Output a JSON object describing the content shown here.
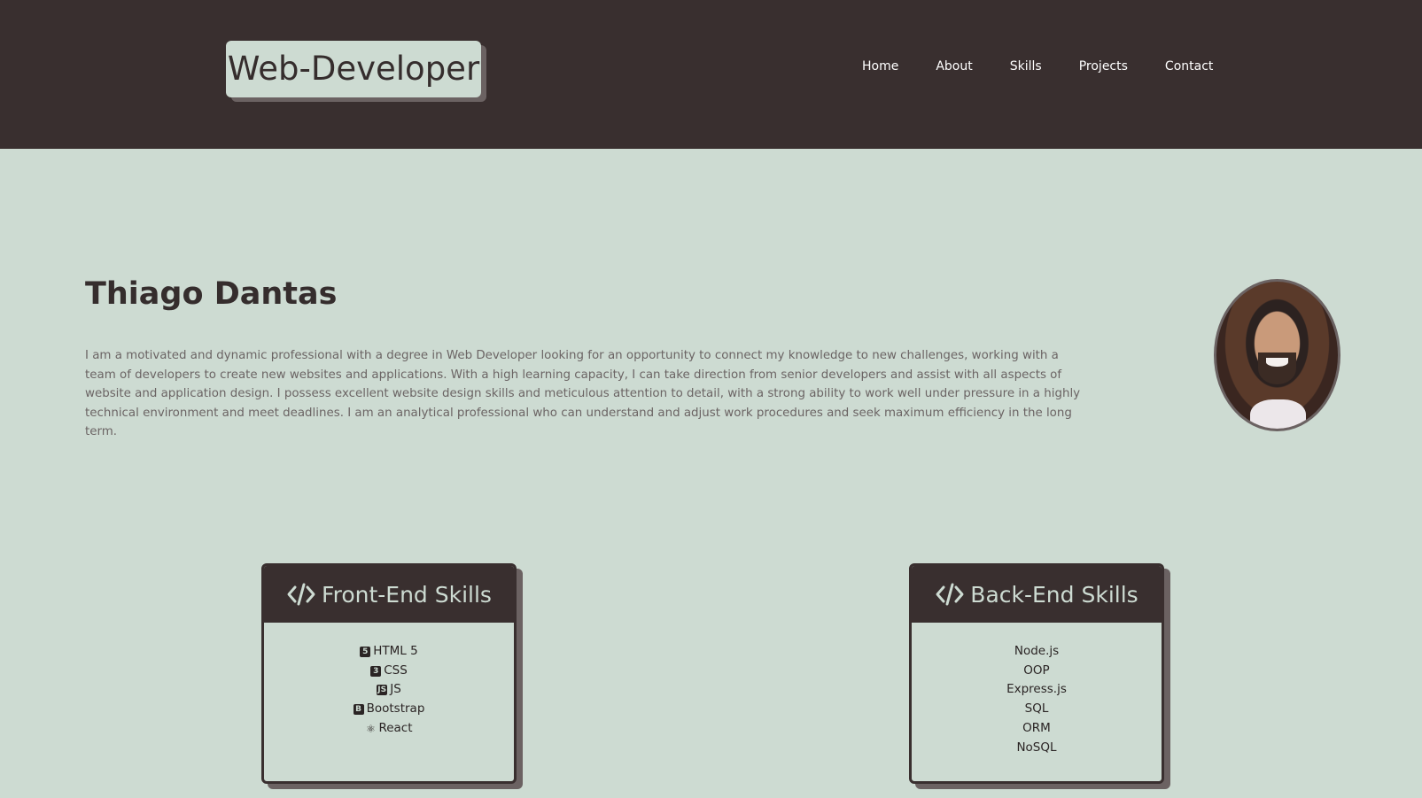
{
  "header": {
    "logo": "Web-Developer",
    "nav": [
      "Home",
      "About",
      "Skills",
      "Projects",
      "Contact"
    ]
  },
  "about": {
    "name": "Thiago Dantas",
    "bio": "I am a motivated and dynamic professional with a degree in Web Developer looking for an opportunity to connect my knowledge to new challenges, working with a team of developers to create new websites and applications. With a high learning capacity, I can take direction from senior developers and assist with all aspects of website and application design. I possess excellent website design skills and meticulous attention to detail, with a strong ability to work well under pressure in a highly technical environment and meet deadlines. I am an analytical professional who can understand and adjust work procedures and seek maximum efficiency in the long term."
  },
  "skills": {
    "front": {
      "title": "Front-End Skills",
      "items": [
        {
          "label": "HTML 5",
          "icon": "html5-icon"
        },
        {
          "label": "CSS",
          "icon": "css3-icon"
        },
        {
          "label": "JS",
          "icon": "js-icon"
        },
        {
          "label": "Bootstrap",
          "icon": "bootstrap-icon"
        },
        {
          "label": "React",
          "icon": "react-icon"
        }
      ]
    },
    "back": {
      "title": "Back-End Skills",
      "items": [
        "Node.js",
        "OOP",
        "Express.js",
        "SQL",
        "ORM",
        "NoSQL"
      ]
    }
  },
  "colors": {
    "header_bg": "#392f2f",
    "page_bg": "#cddbd2",
    "text_dark": "#352d2d"
  }
}
